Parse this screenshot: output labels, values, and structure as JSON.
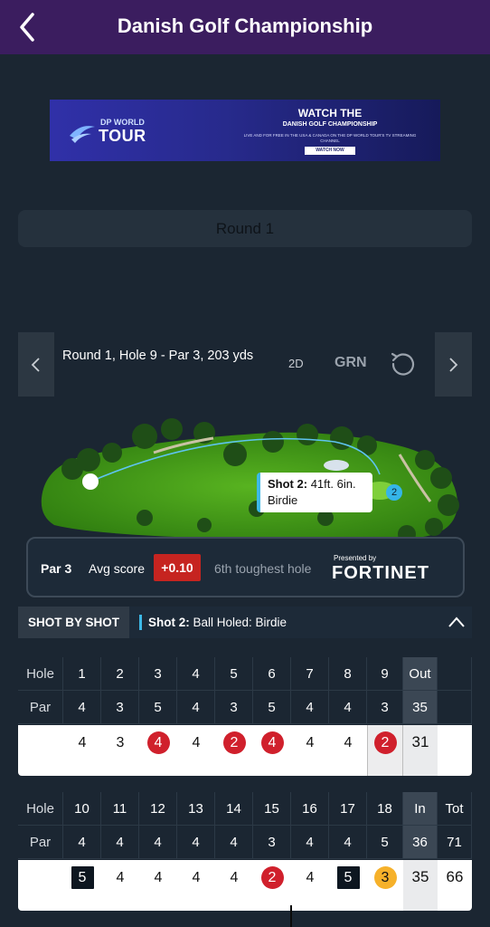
{
  "header": {
    "title": "Danish Golf Championship"
  },
  "ad": {
    "logo_top": "DP WORLD",
    "logo_main": "TOUR",
    "headline": "WATCH THE",
    "event": "DANISH GOLF CHAMPIONSHIP",
    "subtext": "LIVE AND FOR FREE IN THE USA & CANADA ON THE DP WORLD TOUR'S TV STREAMING CHANNEL",
    "cta": "WATCH NOW"
  },
  "round_selector": {
    "label": "Round 1"
  },
  "hole_header": {
    "info": "Round 1, Hole 9 - Par 3, 203 yds",
    "view_2d": "2D",
    "view_grn": "GRN"
  },
  "shot_callout": {
    "title": "Shot 2:",
    "distance": "41ft. 6in.",
    "result": "Birdie",
    "marker": "2"
  },
  "hole_stats": {
    "par": "Par 3",
    "avg_label": "Avg score",
    "avg_value": "+0.10",
    "rank": "6th toughest hole",
    "sponsor_prefix": "Presented by",
    "sponsor": "FORTINET"
  },
  "shot_by_shot": {
    "tab": "SHOT BY SHOT",
    "shot_label": "Shot 2:",
    "shot_text": "Ball Holed: Birdie"
  },
  "scorecard": {
    "front": {
      "hole_label": "Hole",
      "par_label": "Par",
      "holes": [
        "1",
        "2",
        "3",
        "4",
        "5",
        "6",
        "7",
        "8",
        "9"
      ],
      "pars": [
        "4",
        "3",
        "5",
        "4",
        "3",
        "5",
        "4",
        "4",
        "3"
      ],
      "scores": [
        "4",
        "3",
        "4",
        "4",
        "2",
        "4",
        "4",
        "4",
        "2"
      ],
      "total_label": "Out",
      "par_total": "35",
      "score_total": "31"
    },
    "back": {
      "hole_label": "Hole",
      "par_label": "Par",
      "holes": [
        "10",
        "11",
        "12",
        "13",
        "14",
        "15",
        "16",
        "17",
        "18"
      ],
      "pars": [
        "4",
        "4",
        "4",
        "4",
        "4",
        "3",
        "4",
        "4",
        "5"
      ],
      "scores": [
        "5",
        "4",
        "4",
        "4",
        "4",
        "2",
        "4",
        "5",
        "3"
      ],
      "total_label": "In",
      "par_total": "36",
      "score_total": "35",
      "grand_label": "Tot",
      "grand_par": "71",
      "grand_score": "66"
    }
  },
  "colors": {
    "topbar": "#3b1d5f",
    "birdie": "#d0202c",
    "eagle": "#f6b12a",
    "bogey": "#0d1620",
    "accent": "#3db8e6"
  }
}
